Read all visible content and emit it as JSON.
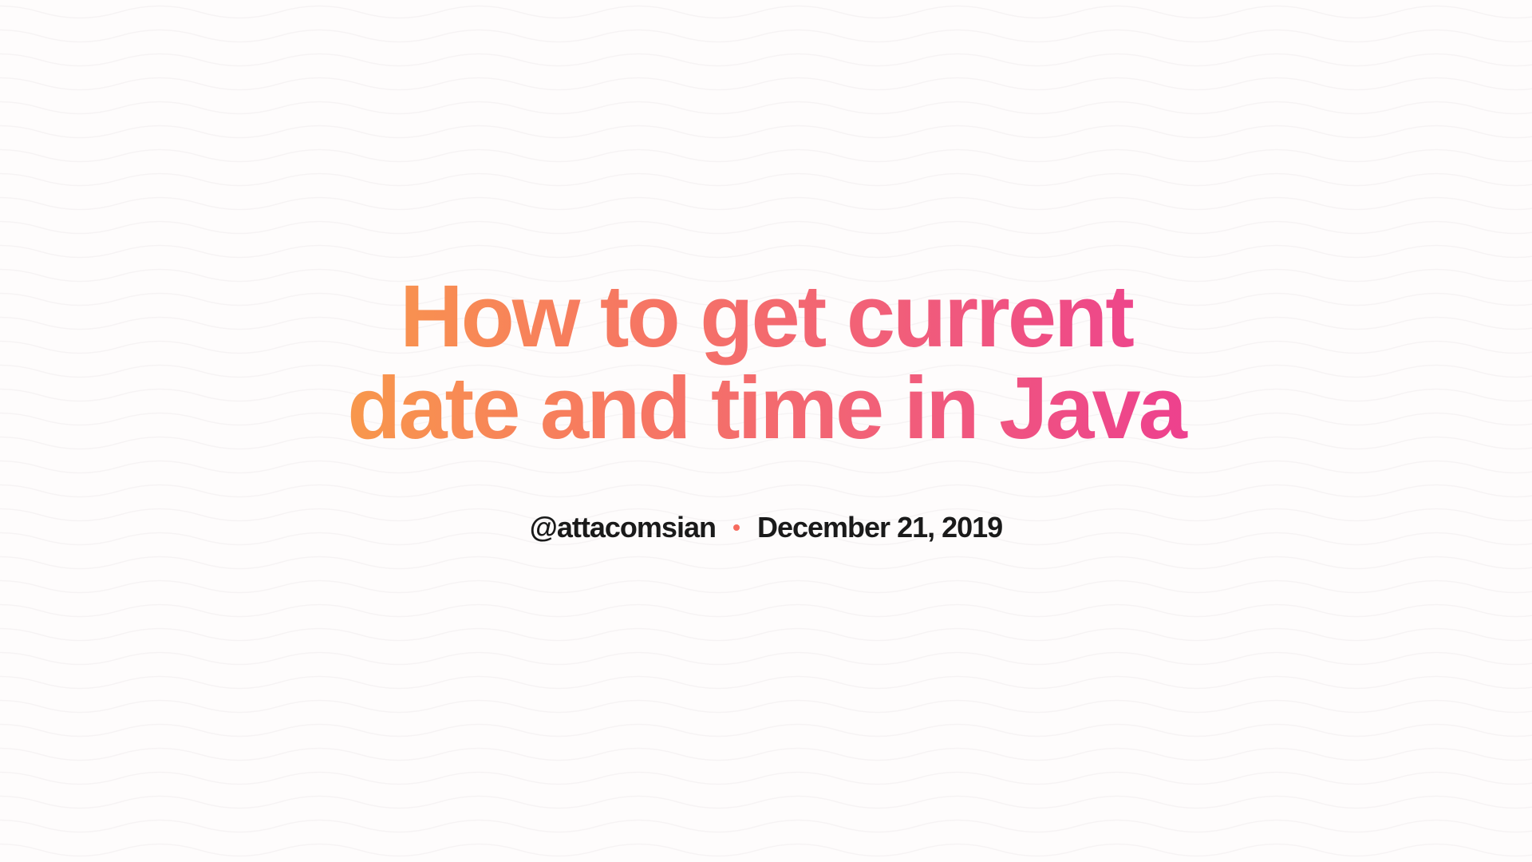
{
  "title": "How to get current date and time in Java",
  "author": "@attacomsian",
  "date": "December 21, 2019",
  "colors": {
    "gradientStart": "#f89a4a",
    "gradientEnd": "#ed3f8f",
    "separatorDot": "#f66b5e",
    "background": "#fefcfc",
    "waveStroke": "#f0eced",
    "metaText": "#1a1a1a"
  }
}
